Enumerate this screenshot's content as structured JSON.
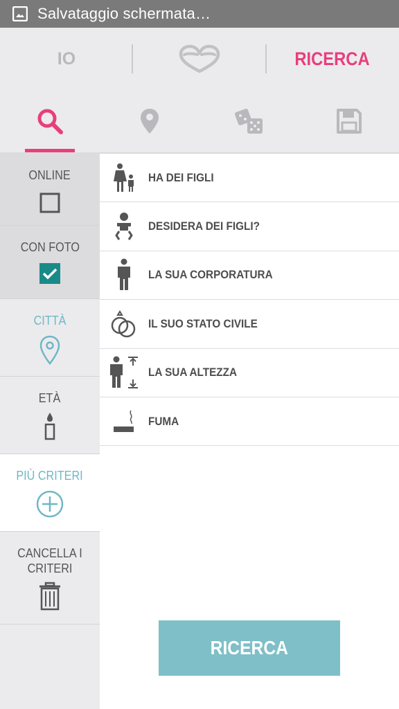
{
  "status_bar": {
    "text": "Salvataggio schermata…"
  },
  "top_tabs": {
    "me_label": "IO",
    "search_label": "RICERCA"
  },
  "icon_tabs": [
    "search-icon",
    "location-icon",
    "dice-icon",
    "save-icon"
  ],
  "sidebar": {
    "items": [
      {
        "label": "ONLINE",
        "checked": false
      },
      {
        "label": "CON FOTO",
        "checked": true
      },
      {
        "label": "CITTÀ"
      },
      {
        "label": "ETÀ"
      },
      {
        "label": "PIÙ CRITERI"
      },
      {
        "label": "CANCELLA I CRITERI"
      }
    ]
  },
  "criteria": [
    {
      "label": "HA DEI FIGLI",
      "icon": "parent-child-icon"
    },
    {
      "label": "DESIDERA DEI FIGLI?",
      "icon": "baby-icon"
    },
    {
      "label": "LA SUA CORPORATURA",
      "icon": "person-icon"
    },
    {
      "label": "IL SUO STATO CIVILE",
      "icon": "rings-icon"
    },
    {
      "label": "LA SUA ALTEZZA",
      "icon": "height-icon"
    },
    {
      "label": "FUMA",
      "icon": "cigarette-icon"
    }
  ],
  "search_button": {
    "label": "RICERCA"
  },
  "colors": {
    "accent": "#e83e7c",
    "teal": "#6fb7c4",
    "button": "#7fbfc8",
    "statusbar": "#7a7a7a",
    "panel": "#ebebee"
  }
}
